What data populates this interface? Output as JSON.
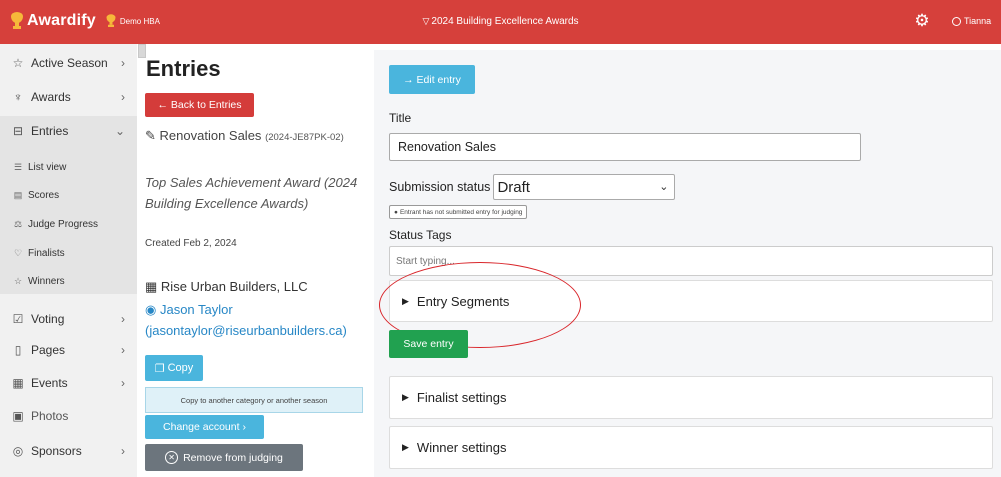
{
  "topbar": {
    "brand": "Awardify",
    "org": "Demo HBA",
    "season": "2024 Building Excellence Awards",
    "user": "Tianna",
    "colors": {
      "bar": "#d6403b",
      "trophy": "#f6b83a"
    }
  },
  "sidebar": {
    "items": [
      {
        "label": "Active Season",
        "icon": "star-icon",
        "glyph": "☆",
        "chevron": "›"
      },
      {
        "label": "Awards",
        "icon": "trophy-icon",
        "glyph": "🏆",
        "chevron": "›"
      },
      {
        "label": "Entries",
        "icon": "inbox-icon",
        "glyph": "⊟",
        "chevron": "⌄"
      },
      {
        "label": "Voting",
        "icon": "ballot-icon",
        "glyph": "☑",
        "chevron": "›"
      },
      {
        "label": "Pages",
        "icon": "file-icon",
        "glyph": "▯",
        "chevron": "›"
      },
      {
        "label": "Events",
        "icon": "calendar-icon",
        "glyph": "▦",
        "chevron": "›"
      },
      {
        "label": "Photos",
        "icon": "image-icon",
        "glyph": "▣",
        "chevron": ""
      },
      {
        "label": "Sponsors",
        "icon": "sponsors-icon",
        "glyph": "◎",
        "chevron": "›"
      }
    ],
    "subitems": [
      {
        "label": "List view",
        "icon": "list-icon",
        "glyph": "☰"
      },
      {
        "label": "Scores",
        "icon": "scores-icon",
        "glyph": "▤"
      },
      {
        "label": "Judge Progress",
        "icon": "gavel-icon",
        "glyph": "⚖"
      },
      {
        "label": "Finalists",
        "icon": "heart-icon",
        "glyph": "♡"
      },
      {
        "label": "Winners",
        "icon": "star-icon",
        "glyph": "☆"
      }
    ]
  },
  "entry": {
    "page_title": "Entries",
    "back_label": "← Back to Entries",
    "name": "Renovation Sales",
    "code": "(2024-JE87PK-02)",
    "award": "Top Sales Achievement Award (2024 Building Excellence Awards)",
    "created": "Created Feb 2, 2024",
    "company": "Rise Urban Builders, LLC",
    "contact_name": "Jason Taylor",
    "contact_email": "(jasontaylor@riseurbanbuilders.ca)",
    "copy_label": "Copy",
    "copy_note": "Copy to another category or another season",
    "change_label": "Change account ›",
    "remove_label": "Remove from judging"
  },
  "form": {
    "edit_label": "→ Edit entry",
    "title_label": "Title",
    "title_value": "Renovation Sales",
    "status_label": "Submission status",
    "status_value": "Draft",
    "status_hint": "Entrant has not submitted entry for judging",
    "tags_label": "Status Tags",
    "tags_placeholder": "Start typing...",
    "segments_label": "Entry Segments",
    "save_label": "Save entry",
    "finalist_label": "Finalist settings",
    "winner_label": "Winner settings",
    "colors": {
      "info": "#4ab5dd",
      "success": "#21a150",
      "danger": "#d43c3a",
      "annotation": "#d9262b"
    }
  }
}
